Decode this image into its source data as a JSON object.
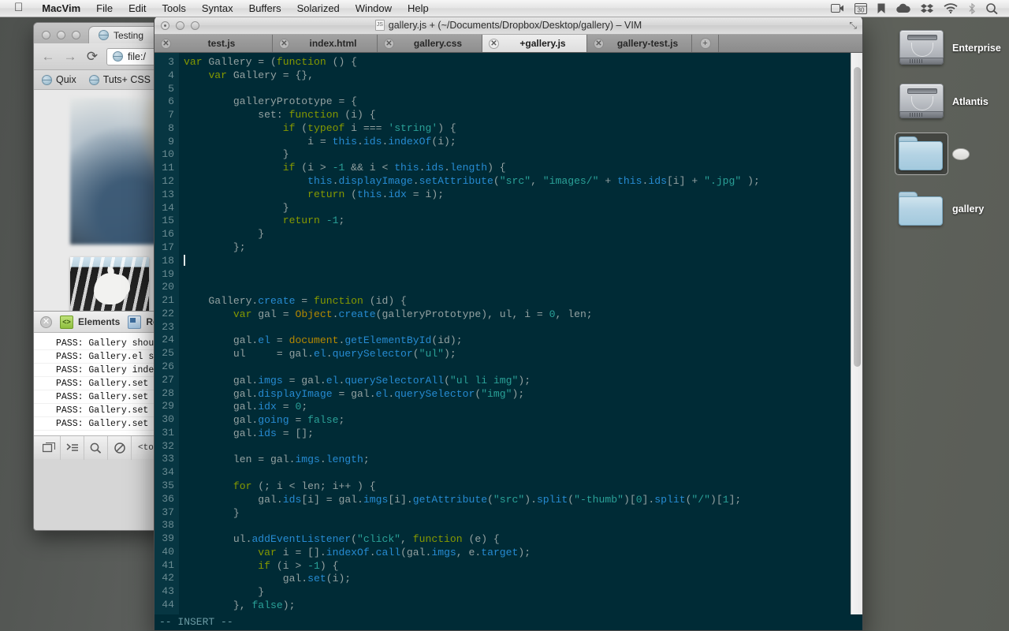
{
  "menubar": {
    "apple_glyph": "",
    "items": [
      {
        "label": "MacVim",
        "bold": true
      },
      {
        "label": "File",
        "bold": false
      },
      {
        "label": "Edit",
        "bold": false
      },
      {
        "label": "Tools",
        "bold": false
      },
      {
        "label": "Syntax",
        "bold": false
      },
      {
        "label": "Buffers",
        "bold": false
      },
      {
        "label": "Solarized",
        "bold": false
      },
      {
        "label": "Window",
        "bold": false
      },
      {
        "label": "Help",
        "bold": false
      }
    ],
    "status_icons": [
      {
        "name": "screen-recording-icon",
        "glyph": "▣"
      },
      {
        "name": "calendar-icon",
        "glyph": "30"
      },
      {
        "name": "bookmark-icon",
        "glyph": "⚑"
      },
      {
        "name": "cloud-icon",
        "glyph": "☁"
      },
      {
        "name": "dropbox-icon",
        "glyph": "❖"
      },
      {
        "name": "wifi-icon",
        "glyph": "◓"
      },
      {
        "name": "bluetooth-icon",
        "glyph": "ᛦ"
      },
      {
        "name": "spotlight-search-icon",
        "glyph": "⌕"
      }
    ]
  },
  "desktop": {
    "icons": [
      {
        "name": "Enterprise",
        "type": "harddrive"
      },
      {
        "name": "Atlantis",
        "type": "harddrive"
      },
      {
        "name": "",
        "type": "folder-selected"
      },
      {
        "name": "gallery",
        "type": "folder"
      }
    ]
  },
  "browser": {
    "tab_title": "Testing",
    "url": "file:/",
    "bookmarks": [
      "Quix",
      "Tuts+ CSS"
    ],
    "nav": {
      "back": "←",
      "forward": "→",
      "reload": "⟳"
    },
    "devtools": {
      "tabs": [
        "Elements",
        "Resources"
      ],
      "elements_icon_text": "<>",
      "console_lines": [
        "PASS: Gallery shou",
        "PASS: Gallery.el s",
        "PASS: Gallery inde",
        "PASS: Gallery.set",
        "PASS: Gallery.set",
        "PASS: Gallery.set",
        "PASS: Gallery.set"
      ],
      "prompt": "›",
      "footer_buttons": [
        "dock-icon",
        "console-icon",
        "search-icon",
        "clear-icon"
      ],
      "footer_crumb": "<to"
    }
  },
  "vim": {
    "title": "gallery.js + (~/Documents/Dropbox/Desktop/gallery) – VIM",
    "doc_icon_text": "JS",
    "fullscreen_glyph": "⤡",
    "tabs": [
      {
        "label": "test.js",
        "active": false
      },
      {
        "label": "index.html",
        "active": false
      },
      {
        "label": "gallery.css",
        "active": false
      },
      {
        "label": "+gallery.js",
        "active": true
      },
      {
        "label": "gallery-test.js",
        "active": false
      }
    ],
    "tab_close_glyph": "✕",
    "new_tab_glyph": "+",
    "statusline": "-- INSERT --",
    "first_line_number": 3,
    "lines": [
      {
        "n": 3,
        "text": "var Gallery = (function () {"
      },
      {
        "n": 4,
        "text": "    var Gallery = {},"
      },
      {
        "n": 5,
        "text": ""
      },
      {
        "n": 6,
        "text": "        galleryPrototype = {"
      },
      {
        "n": 7,
        "text": "            set: function (i) {"
      },
      {
        "n": 8,
        "text": "                if (typeof i === 'string') {"
      },
      {
        "n": 9,
        "text": "                    i = this.ids.indexOf(i);"
      },
      {
        "n": 10,
        "text": "                }"
      },
      {
        "n": 11,
        "text": "                if (i > -1 && i < this.ids.length) {"
      },
      {
        "n": 12,
        "text": "                    this.displayImage.setAttribute(\"src\", \"images/\" + this.ids[i] + \".jpg\" );"
      },
      {
        "n": 13,
        "text": "                    return (this.idx = i);"
      },
      {
        "n": 14,
        "text": "                }"
      },
      {
        "n": 15,
        "text": "                return -1;"
      },
      {
        "n": 16,
        "text": "            }"
      },
      {
        "n": 17,
        "text": "        };"
      },
      {
        "n": 18,
        "text": "",
        "cursor": true
      },
      {
        "n": 19,
        "text": ""
      },
      {
        "n": 20,
        "text": ""
      },
      {
        "n": 21,
        "text": "    Gallery.create = function (id) {"
      },
      {
        "n": 22,
        "text": "        var gal = Object.create(galleryPrototype), ul, i = 0, len;"
      },
      {
        "n": 23,
        "text": ""
      },
      {
        "n": 24,
        "text": "        gal.el = document.getElementById(id);"
      },
      {
        "n": 25,
        "text": "        ul     = gal.el.querySelector(\"ul\");"
      },
      {
        "n": 26,
        "text": ""
      },
      {
        "n": 27,
        "text": "        gal.imgs = gal.el.querySelectorAll(\"ul li img\");"
      },
      {
        "n": 28,
        "text": "        gal.displayImage = gal.el.querySelector(\"img\");"
      },
      {
        "n": 29,
        "text": "        gal.idx = 0;"
      },
      {
        "n": 30,
        "text": "        gal.going = false;"
      },
      {
        "n": 31,
        "text": "        gal.ids = [];"
      },
      {
        "n": 32,
        "text": ""
      },
      {
        "n": 33,
        "text": "        len = gal.imgs.length;"
      },
      {
        "n": 34,
        "text": ""
      },
      {
        "n": 35,
        "text": "        for (; i < len; i++ ) {"
      },
      {
        "n": 36,
        "text": "            gal.ids[i] = gal.imgs[i].getAttribute(\"src\").split(\"-thumb\")[0].split(\"/\")[1];"
      },
      {
        "n": 37,
        "text": "        }"
      },
      {
        "n": 38,
        "text": ""
      },
      {
        "n": 39,
        "text": "        ul.addEventListener(\"click\", function (e) {"
      },
      {
        "n": 40,
        "text": "            var i = [].indexOf.call(gal.imgs, e.target);"
      },
      {
        "n": 41,
        "text": "            if (i > -1) {"
      },
      {
        "n": 42,
        "text": "                gal.set(i);"
      },
      {
        "n": 43,
        "text": "            }"
      },
      {
        "n": 44,
        "text": "        }, false);"
      }
    ]
  },
  "colors": {
    "vim_bg": "#002b36",
    "vim_gutter": "#073642",
    "vim_fg": "#93a1a1",
    "keyword_green": "#859900",
    "string_cyan": "#2aa198",
    "blue": "#268bd2",
    "yellow": "#b58900",
    "desktop": "#5c5f5c"
  }
}
